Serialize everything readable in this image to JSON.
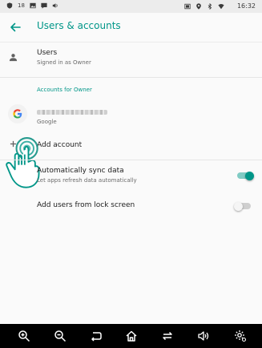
{
  "status_bar": {
    "notification_count": "18",
    "time": "16:32"
  },
  "app_bar": {
    "title": "Users & accounts"
  },
  "users": {
    "label": "Users",
    "subtitle": "Signed in as Owner"
  },
  "accounts_section": {
    "header": "Accounts for Owner",
    "google_account": {
      "provider": "Google"
    },
    "add_account_label": "Add account"
  },
  "sync": {
    "label": "Automatically sync data",
    "subtitle": "Let apps refresh data automatically",
    "enabled": true
  },
  "lock_screen": {
    "label": "Add users from lock screen",
    "enabled": false
  },
  "colors": {
    "accent": "#009688",
    "toggle_off_track": "#cfcfcf",
    "toggle_off_knob": "#f5f5f5"
  },
  "nav_bar": {
    "icons": [
      "zoom-in-icon",
      "zoom-out-icon",
      "back-icon",
      "home-icon",
      "recents-icon",
      "volume-icon",
      "settings-icon"
    ]
  }
}
